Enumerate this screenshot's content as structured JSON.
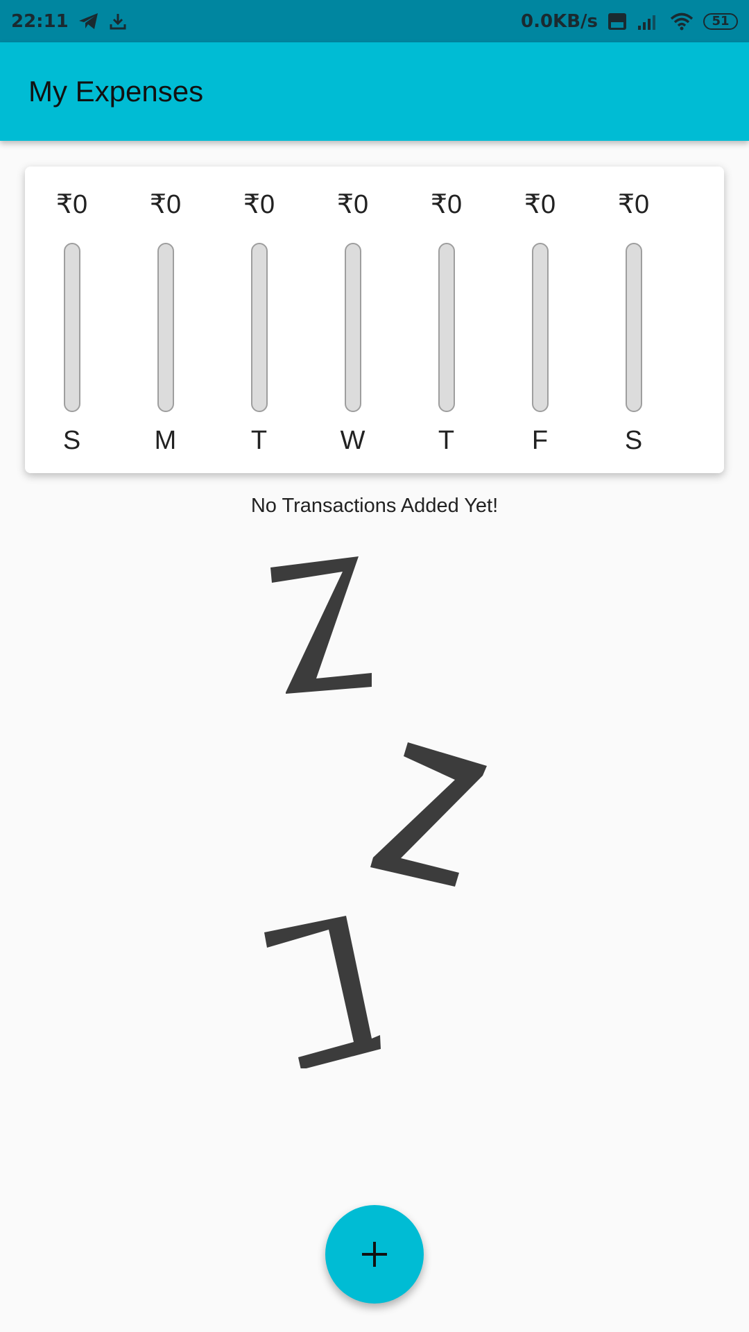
{
  "status_bar": {
    "time": "22:11",
    "network_speed": "0.0KB/s",
    "battery": "51",
    "icons": [
      "telegram-icon",
      "download-icon",
      "volte-icon",
      "signal-icon",
      "wifi-icon",
      "battery-icon"
    ]
  },
  "app_bar": {
    "title": "My Expenses"
  },
  "chart": {
    "days": [
      {
        "amount": "₹0",
        "label": "S",
        "fill": 0
      },
      {
        "amount": "₹0",
        "label": "M",
        "fill": 0
      },
      {
        "amount": "₹0",
        "label": "T",
        "fill": 0
      },
      {
        "amount": "₹0",
        "label": "W",
        "fill": 0
      },
      {
        "amount": "₹0",
        "label": "T",
        "fill": 0
      },
      {
        "amount": "₹0",
        "label": "F",
        "fill": 0
      },
      {
        "amount": "₹0",
        "label": "S",
        "fill": 0
      }
    ]
  },
  "empty_state": {
    "message": "No Transactions Added Yet!",
    "illustration": "zzz-icon"
  },
  "fab": {
    "icon": "plus-icon"
  },
  "colors": {
    "accent": "#00bcd4",
    "status_bar": "#0086a0",
    "background": "#fafafa"
  }
}
